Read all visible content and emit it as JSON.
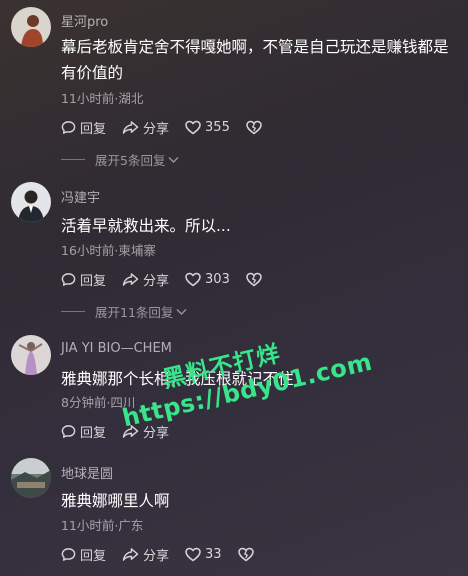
{
  "comments": [
    {
      "username": "星河pro",
      "text": "幕后老板肯定舍不得嘎她啊，不管是自己玩还是赚钱都是有价值的",
      "meta": "11小时前·湖北",
      "reply_label": "回复",
      "share_label": "分享",
      "likes": "355",
      "expand": "展开5条回复"
    },
    {
      "username": "冯建宇",
      "text": "活着早就救出来。所以...",
      "meta": "16小时前·柬埔寨",
      "reply_label": "回复",
      "share_label": "分享",
      "likes": "303",
      "expand": "展开11条回复"
    },
    {
      "username": "JIA YI BIO—CHEM",
      "text": "雅典娜那个长相，我压根就记不住",
      "meta": "8分钟前·四川",
      "reply_label": "回复",
      "share_label": "分享",
      "likes": ""
    },
    {
      "username": "地球是圆",
      "text": "雅典娜哪里人啊",
      "meta": "11小时前·广东",
      "reply_label": "回复",
      "share_label": "分享",
      "likes": "33"
    }
  ],
  "watermark": {
    "line1": "黑料不打烊",
    "line2": "https://bdy01.com"
  },
  "icons": {
    "reply": "comment-bubble-icon",
    "share": "share-arrow-icon",
    "like": "heart-icon",
    "dislike": "broken-heart-icon",
    "expand": "chevron-down-icon"
  },
  "colors": {
    "watermark": "#38e58a"
  }
}
